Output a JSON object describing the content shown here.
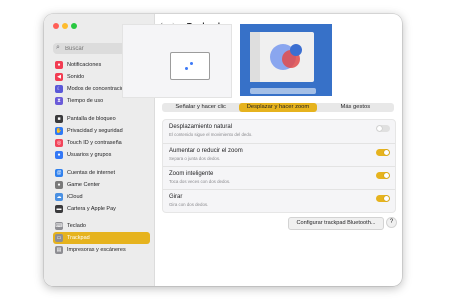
{
  "window": {
    "title": "Trackpad"
  },
  "search": {
    "placeholder": "Buscar"
  },
  "sidebar": {
    "items": [
      {
        "label": "Notificaciones",
        "icon": "bell-icon",
        "color": "#f23c52",
        "glyph": "●"
      },
      {
        "label": "Sonido",
        "icon": "speaker-icon",
        "color": "#f23c52",
        "glyph": "◀"
      },
      {
        "label": "Modos de concentración",
        "icon": "moon-icon",
        "color": "#5a58d8",
        "glyph": "☾"
      },
      {
        "label": "Tiempo de uso",
        "icon": "hourglass-icon",
        "color": "#6a5ad8",
        "glyph": "⧗"
      },
      {
        "label": "Pantalla de bloqueo",
        "icon": "lock-icon",
        "color": "#3a3a3c",
        "glyph": "■"
      },
      {
        "label": "Privacidad y seguridad",
        "icon": "hand-icon",
        "color": "#2f7af5",
        "glyph": "✋"
      },
      {
        "label": "Touch ID y contraseña",
        "icon": "fingerprint-icon",
        "color": "#f2445a",
        "glyph": "◎"
      },
      {
        "label": "Usuarios y grupos",
        "icon": "users-icon",
        "color": "#3478f6",
        "glyph": "●"
      },
      {
        "label": "Cuentas de internet",
        "icon": "at-icon",
        "color": "#2f80ed",
        "glyph": "@"
      },
      {
        "label": "Game Center",
        "icon": "game-center-icon",
        "color": "#7a7a7a",
        "glyph": "●"
      },
      {
        "label": "iCloud",
        "icon": "cloud-icon",
        "color": "#4a90e2",
        "glyph": "☁"
      },
      {
        "label": "Cartera y Apple Pay",
        "icon": "wallet-icon",
        "color": "#3a3a3c",
        "glyph": "▬"
      },
      {
        "label": "Teclado",
        "icon": "keyboard-icon",
        "color": "#8e8e93",
        "glyph": "⌨"
      },
      {
        "label": "Trackpad",
        "icon": "trackpad-icon",
        "color": "#8e8e93",
        "glyph": "▭"
      },
      {
        "label": "Impresoras y escáneres",
        "icon": "printer-icon",
        "color": "#8e8e93",
        "glyph": "▤"
      }
    ]
  },
  "tabs": [
    {
      "label": "Señalar y hacer clic"
    },
    {
      "label": "Desplazar y hacer zoom"
    },
    {
      "label": "Más gestos"
    }
  ],
  "settings": [
    {
      "title": "Desplazamiento natural",
      "desc": "El contenido sigue el movimiento del dedo.",
      "on": false
    },
    {
      "title": "Aumentar o reducir el zoom",
      "desc": "Separa o junta dos dedos.",
      "on": true
    },
    {
      "title": "Zoom inteligente",
      "desc": "Toca dos veces con dos dedos.",
      "on": true
    },
    {
      "title": "Girar",
      "desc": "Gira con dos dedos.",
      "on": true
    }
  ],
  "buttons": {
    "configure": "Configurar trackpad Bluetooth...",
    "help": "?"
  },
  "colors": {
    "accent": "#e6b31e"
  }
}
